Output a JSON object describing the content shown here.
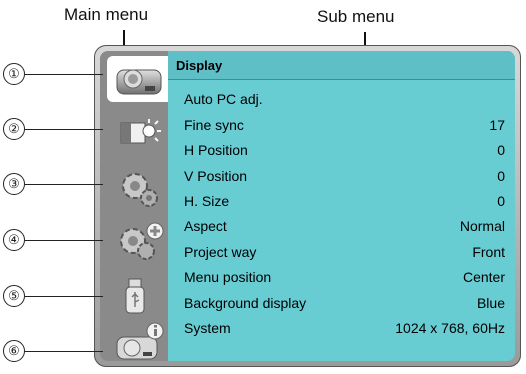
{
  "captions": {
    "main_menu": "Main menu",
    "sub_menu": "Sub menu"
  },
  "markers": [
    "①",
    "②",
    "③",
    "④",
    "⑤",
    "⑥"
  ],
  "main_menu": {
    "tabs": [
      {
        "icon": "display-icon",
        "selected": true
      },
      {
        "icon": "image-adjust-icon",
        "selected": false
      },
      {
        "icon": "setting-gear-icon",
        "selected": false
      },
      {
        "icon": "expanded-setting-icon",
        "selected": false
      },
      {
        "icon": "usb-memory-icon",
        "selected": false
      },
      {
        "icon": "information-icon",
        "selected": false
      }
    ]
  },
  "sub_menu": {
    "title": "Display",
    "rows": [
      {
        "label": "Auto PC adj.",
        "value": ""
      },
      {
        "label": "Fine sync",
        "value": "17"
      },
      {
        "label": "H Position",
        "value": "0"
      },
      {
        "label": "V Position",
        "value": "0"
      },
      {
        "label": "H. Size",
        "value": "0"
      },
      {
        "label": "Aspect",
        "value": "Normal"
      },
      {
        "label": "Project way",
        "value": "Front"
      },
      {
        "label": "Menu position",
        "value": "Center"
      },
      {
        "label": "Background display",
        "value": "Blue"
      },
      {
        "label": "System",
        "value": "1024 x 768, 60Hz"
      }
    ]
  },
  "colors": {
    "panel": "#68ccd3",
    "main_bg": "#8a8a8a",
    "selected_tab": "#ffffff"
  }
}
